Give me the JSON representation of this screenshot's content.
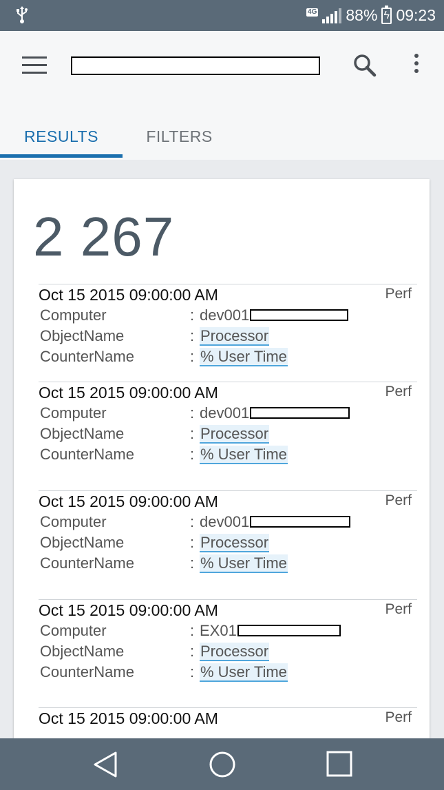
{
  "status_bar": {
    "network": "4G",
    "battery": "88%",
    "time": "09:23",
    "icons": [
      "usb-icon",
      "signal-icon",
      "battery-charging-icon"
    ]
  },
  "app_bar": {
    "icons": [
      "menu-icon",
      "search-icon",
      "more-vert-icon"
    ]
  },
  "tabs": [
    {
      "label": "RESULTS",
      "active": true
    },
    {
      "label": "FILTERS",
      "active": false
    }
  ],
  "results": {
    "total": "2 267",
    "field_labels": {
      "computer": "Computer",
      "object": "ObjectName",
      "counter": "CounterName"
    },
    "records": [
      {
        "timestamp": "Oct 15 2015 09:00:00 AM",
        "type": "Perf",
        "computer": "dev001",
        "object_name": "Processor",
        "counter_name": "% User Time"
      },
      {
        "timestamp": "Oct 15 2015 09:00:00 AM",
        "type": "Perf",
        "computer": "dev001",
        "object_name": "Processor",
        "counter_name": "% User Time"
      },
      {
        "timestamp": "Oct 15 2015 09:00:00 AM",
        "type": "Perf",
        "computer": "dev001",
        "object_name": "Processor",
        "counter_name": "% User Time"
      },
      {
        "timestamp": "Oct 15 2015 09:00:00 AM",
        "type": "Perf",
        "computer": "EX01",
        "object_name": "Processor",
        "counter_name": "% User Time"
      },
      {
        "timestamp": "Oct 15 2015 09:00:00 AM",
        "type": "Perf"
      }
    ]
  },
  "nav_bar": {
    "icons": [
      "back-icon",
      "home-icon",
      "recents-icon"
    ]
  },
  "colors": {
    "accent": "#1b6fae",
    "status_bar": "#5a6a78",
    "link_underline": "#4fa6dc"
  }
}
